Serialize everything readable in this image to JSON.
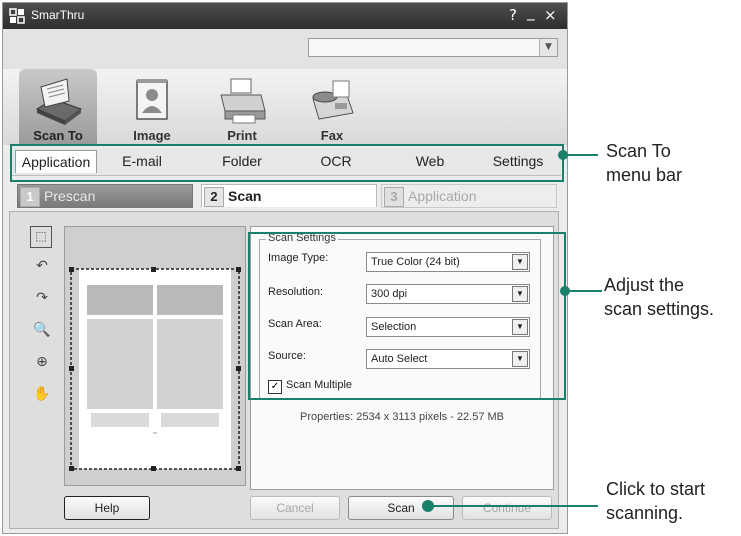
{
  "window": {
    "title": "SmarThru",
    "help_icon": "?",
    "minimize_icon": "_",
    "close_icon": "×"
  },
  "toolbar": {
    "items": [
      {
        "label": "Scan To",
        "icon": "scanner-icon",
        "active": true
      },
      {
        "label": "Image",
        "icon": "image-icon",
        "active": false
      },
      {
        "label": "Print",
        "icon": "printer-icon",
        "active": false
      },
      {
        "label": "Fax",
        "icon": "fax-icon",
        "active": false
      }
    ]
  },
  "menu": {
    "tabs": [
      {
        "label": "Application",
        "active": true
      },
      {
        "label": "E-mail"
      },
      {
        "label": "Folder"
      },
      {
        "label": "OCR"
      },
      {
        "label": "Web"
      },
      {
        "label": "Settings"
      }
    ]
  },
  "steps": [
    {
      "num": "1",
      "label": "Prescan"
    },
    {
      "num": "2",
      "label": "Scan"
    },
    {
      "num": "3",
      "label": "Application"
    }
  ],
  "scan_settings": {
    "group_label": "Scan Settings",
    "image_type_label": "Image Type:",
    "image_type_value": "True Color (24 bit)",
    "resolution_label": "Resolution:",
    "resolution_value": "300 dpi",
    "scan_area_label": "Scan Area:",
    "scan_area_value": "Selection",
    "source_label": "Source:",
    "source_value": "Auto Select",
    "scan_multiple_label": "Scan Multiple",
    "scan_multiple_checked": true
  },
  "properties": "Properties: 2534 x 3113 pixels - 22.57 MB",
  "buttons": {
    "help": "Help",
    "cancel": "Cancel",
    "scan": "Scan",
    "continue": "Continue"
  },
  "callouts": {
    "menu_bar": [
      "Scan To",
      "menu bar"
    ],
    "settings": [
      "Adjust the",
      "scan settings."
    ],
    "scan": [
      "Click to start",
      "scanning."
    ]
  },
  "colors": {
    "callout_line": "#1a7f6b",
    "titlebar": "#3a3a3a",
    "active_step": "#ffffff"
  }
}
